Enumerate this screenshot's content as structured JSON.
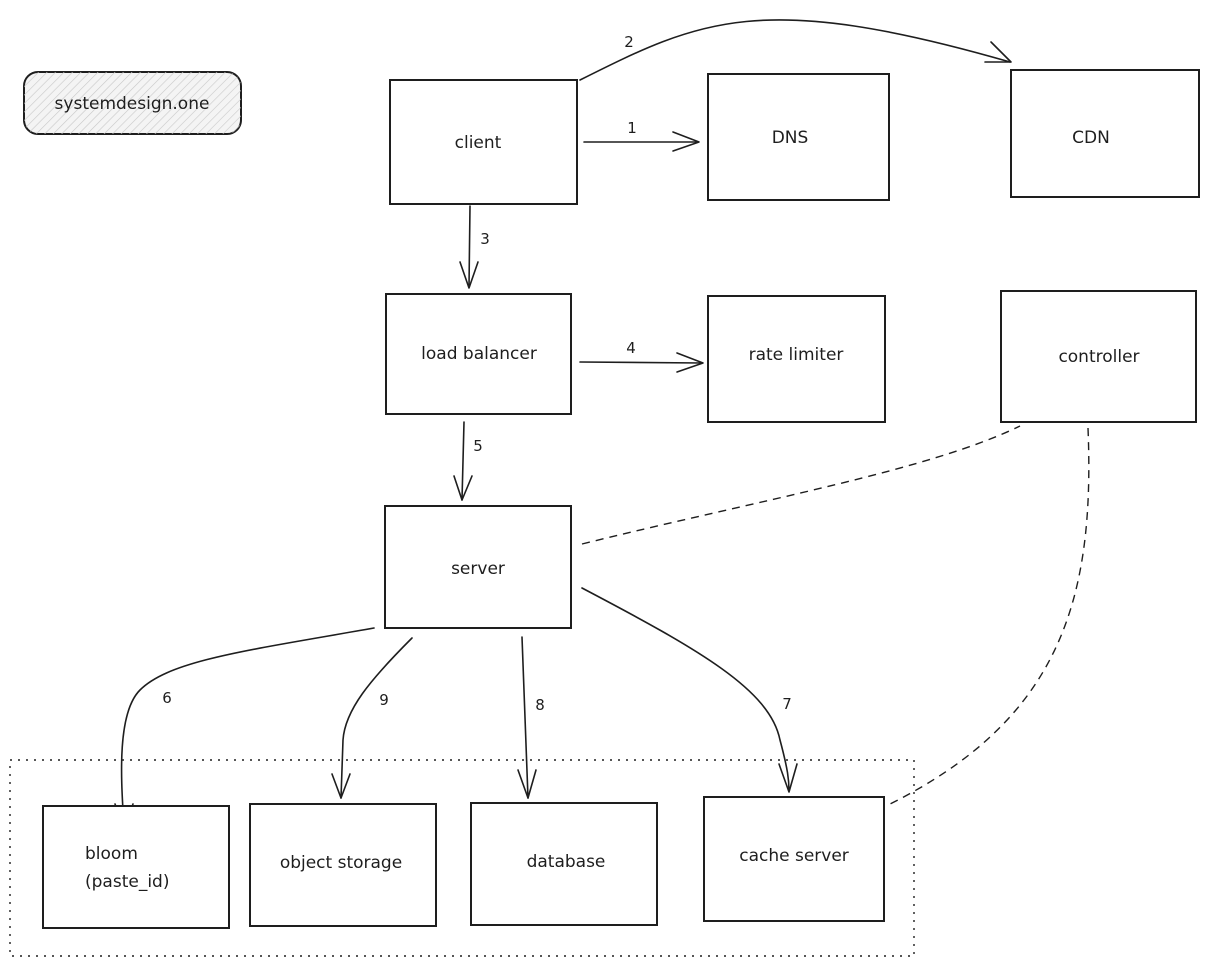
{
  "badge": {
    "label": "systemdesign.one"
  },
  "nodes": {
    "client": {
      "label": "client"
    },
    "dns": {
      "label": "DNS"
    },
    "cdn": {
      "label": "CDN"
    },
    "load_balancer": {
      "label": "load balancer"
    },
    "rate_limiter": {
      "label": "rate limiter"
    },
    "controller": {
      "label": "controller"
    },
    "server": {
      "label": "server"
    },
    "bloom": {
      "label_line1": "bloom",
      "label_line2": "(paste_id)"
    },
    "object_storage": {
      "label": "object storage"
    },
    "database": {
      "label": "database"
    },
    "cache_server": {
      "label": "cache server"
    }
  },
  "edges": {
    "client_dns": {
      "step": "1"
    },
    "client_cdn": {
      "step": "2"
    },
    "client_lb": {
      "step": "3"
    },
    "lb_rate_limiter": {
      "step": "4"
    },
    "lb_server": {
      "step": "5"
    },
    "server_bloom": {
      "step": "6"
    },
    "server_cache": {
      "step": "7"
    },
    "server_database": {
      "step": "8"
    },
    "server_object_storage": {
      "step": "9"
    }
  }
}
